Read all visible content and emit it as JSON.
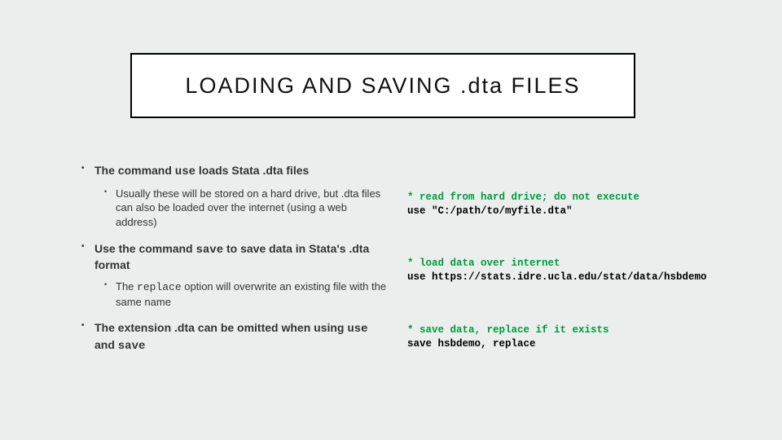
{
  "title": "LOADING AND SAVING .dta FILES",
  "bullets": {
    "b1": {
      "pre": "The command ",
      "code": "use",
      "post": " loads Stata .dta files",
      "sub": "Usually these will be stored on a hard drive, but .dta files can also be loaded over the internet (using a web address)"
    },
    "b2": {
      "pre": "Use the command ",
      "code": "save",
      "post": " to save data in Stata's .dta format",
      "sub_pre": "The ",
      "sub_code": "replace",
      "sub_post": " option will overwrite an existing file with the same name"
    },
    "b3": {
      "pre": "The extension .dta can be omitted when using ",
      "code1": "use",
      "mid": " and ",
      "code2": "save"
    }
  },
  "code": {
    "c1_comment": "* read from hard drive; do not execute",
    "c1_cmd": "use \"C:/path/to/myfile.dta\"",
    "c2_comment": "* load data over internet",
    "c2_cmd": "use https://stats.idre.ucla.edu/stat/data/hsbdemo",
    "c3_comment": "* save data, replace if it exists",
    "c3_cmd": "save hsbdemo, replace"
  }
}
